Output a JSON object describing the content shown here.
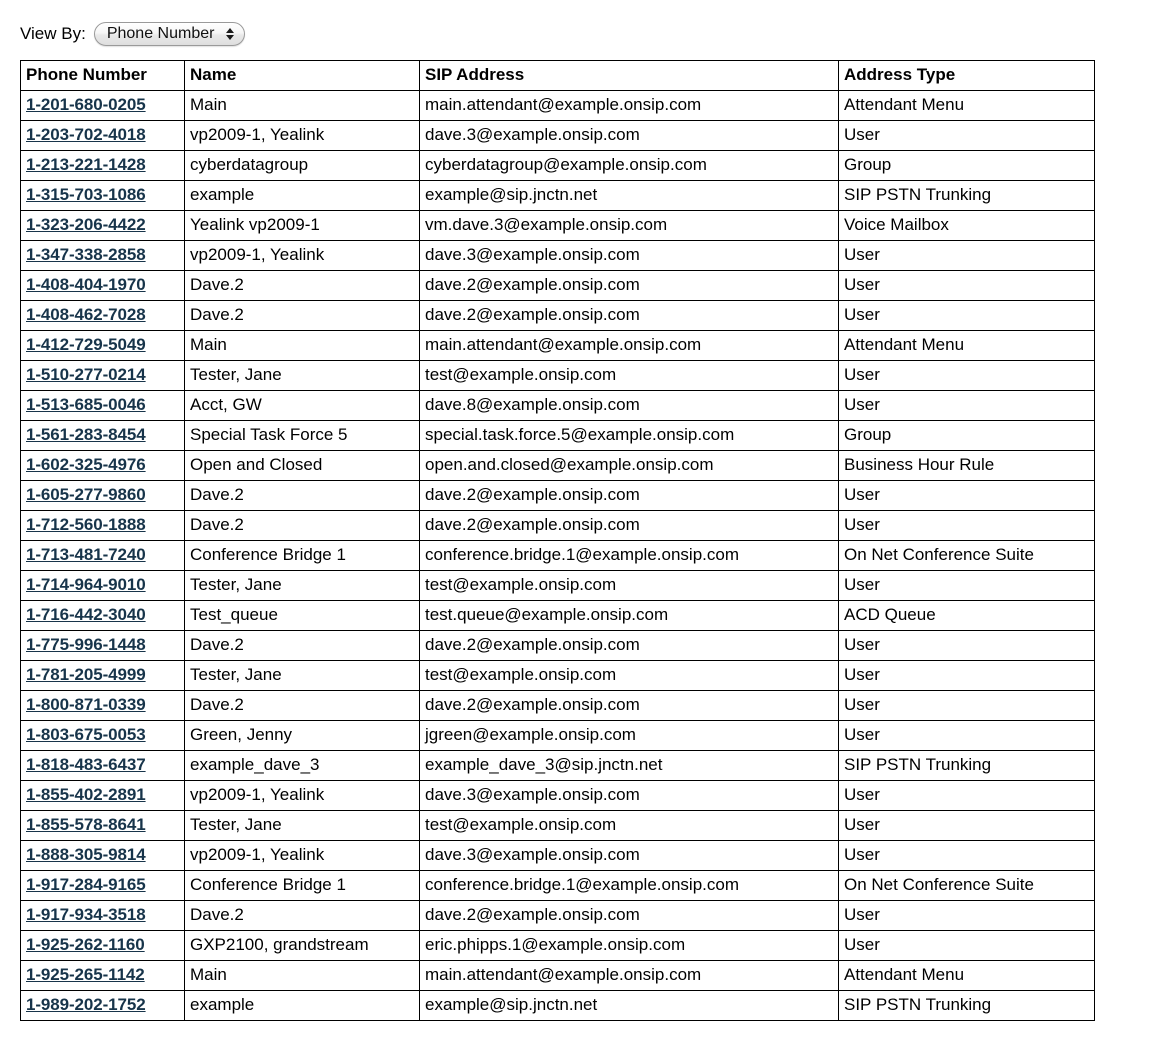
{
  "toolbar": {
    "view_by_label": "View By:",
    "view_by_selected": "Phone Number",
    "view_by_options": [
      "Phone Number"
    ],
    "stepper_icon": "up-down-arrows-icon"
  },
  "table": {
    "columns": [
      "Phone Number",
      "Name",
      "SIP Address",
      "Address Type"
    ],
    "rows": [
      [
        "1-201-680-0205",
        "Main",
        "main.attendant@example.onsip.com",
        "Attendant Menu"
      ],
      [
        "1-203-702-4018",
        "vp2009-1, Yealink",
        "dave.3@example.onsip.com",
        "User"
      ],
      [
        "1-213-221-1428",
        "cyberdatagroup",
        "cyberdatagroup@example.onsip.com",
        "Group"
      ],
      [
        "1-315-703-1086",
        "example",
        "example@sip.jnctn.net",
        "SIP PSTN Trunking"
      ],
      [
        "1-323-206-4422",
        "Yealink vp2009-1",
        "vm.dave.3@example.onsip.com",
        "Voice Mailbox"
      ],
      [
        "1-347-338-2858",
        "vp2009-1, Yealink",
        "dave.3@example.onsip.com",
        "User"
      ],
      [
        "1-408-404-1970",
        "Dave.2",
        "dave.2@example.onsip.com",
        "User"
      ],
      [
        "1-408-462-7028",
        "Dave.2",
        "dave.2@example.onsip.com",
        "User"
      ],
      [
        "1-412-729-5049",
        "Main",
        "main.attendant@example.onsip.com",
        "Attendant Menu"
      ],
      [
        "1-510-277-0214",
        "Tester, Jane",
        "test@example.onsip.com",
        "User"
      ],
      [
        "1-513-685-0046",
        "Acct, GW",
        "dave.8@example.onsip.com",
        "User"
      ],
      [
        "1-561-283-8454",
        "Special Task Force 5",
        "special.task.force.5@example.onsip.com",
        "Group"
      ],
      [
        "1-602-325-4976",
        "Open and Closed",
        "open.and.closed@example.onsip.com",
        "Business Hour Rule"
      ],
      [
        "1-605-277-9860",
        "Dave.2",
        "dave.2@example.onsip.com",
        "User"
      ],
      [
        "1-712-560-1888",
        "Dave.2",
        "dave.2@example.onsip.com",
        "User"
      ],
      [
        "1-713-481-7240",
        "Conference Bridge 1",
        "conference.bridge.1@example.onsip.com",
        "On Net Conference Suite"
      ],
      [
        "1-714-964-9010",
        "Tester, Jane",
        "test@example.onsip.com",
        "User"
      ],
      [
        "1-716-442-3040",
        "Test_queue",
        "test.queue@example.onsip.com",
        "ACD Queue"
      ],
      [
        "1-775-996-1448",
        "Dave.2",
        "dave.2@example.onsip.com",
        "User"
      ],
      [
        "1-781-205-4999",
        "Tester, Jane",
        "test@example.onsip.com",
        "User"
      ],
      [
        "1-800-871-0339",
        "Dave.2",
        "dave.2@example.onsip.com",
        "User"
      ],
      [
        "1-803-675-0053",
        "Green, Jenny",
        "jgreen@example.onsip.com",
        "User"
      ],
      [
        "1-818-483-6437",
        "example_dave_3",
        "example_dave_3@sip.jnctn.net",
        "SIP PSTN Trunking"
      ],
      [
        "1-855-402-2891",
        "vp2009-1, Yealink",
        "dave.3@example.onsip.com",
        "User"
      ],
      [
        "1-855-578-8641",
        "Tester, Jane",
        "test@example.onsip.com",
        "User"
      ],
      [
        "1-888-305-9814",
        "vp2009-1, Yealink",
        "dave.3@example.onsip.com",
        "User"
      ],
      [
        "1-917-284-9165",
        "Conference Bridge 1",
        "conference.bridge.1@example.onsip.com",
        "On Net Conference Suite"
      ],
      [
        "1-917-934-3518",
        "Dave.2",
        "dave.2@example.onsip.com",
        "User"
      ],
      [
        "1-925-262-1160",
        "GXP2100, grandstream",
        "eric.phipps.1@example.onsip.com",
        "User"
      ],
      [
        "1-925-265-1142",
        "Main",
        "main.attendant@example.onsip.com",
        "Attendant Menu"
      ],
      [
        "1-989-202-1752",
        "example",
        "example@sip.jnctn.net",
        "SIP PSTN Trunking"
      ]
    ]
  },
  "colors": {
    "link": "#17344a",
    "border": "#000000",
    "background": "#ffffff",
    "text": "#000000"
  }
}
